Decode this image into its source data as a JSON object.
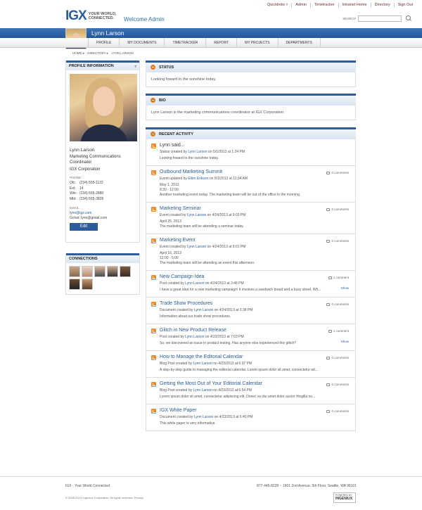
{
  "topnav": [
    "Quicklinks ▿",
    "Admin",
    "Timetracker",
    "Intranet Home",
    "Directory",
    "Sign Out"
  ],
  "logo": {
    "mark": "IGX",
    "tagline": "YOUR WORLD, CONNECTED."
  },
  "welcome": "Welcome Admin",
  "search": {
    "label": "SEARCH",
    "placeholder": ""
  },
  "user": {
    "name": "Lynn Larson"
  },
  "tabs": [
    "PROFILE",
    "MY DOCUMENTS",
    "TIMETRACKER",
    "REPORT",
    "MY PROJECTS",
    "DEPARTMENTS"
  ],
  "breadcrumb": [
    "HOME ▸",
    "DIRECTORY ▸",
    "LYNN LARSON"
  ],
  "profile": {
    "heading": "PROFILE INFORMATION",
    "name": "Lynn Larson",
    "title": "Marketing Communications Coordinator",
    "company": "IGX Corporation",
    "phone_label": "PHONE:",
    "phones": [
      {
        "k": "Ofc:",
        "v": "(234) 555-1122"
      },
      {
        "k": "Ext:",
        "v": "14"
      },
      {
        "k": "Wrk:",
        "v": "(234) 555-2880"
      },
      {
        "k": "Mbl:",
        "v": "(234) 555-3828"
      }
    ],
    "email_label": "EMAIL:",
    "email": "lynn@igx.com",
    "gchat": "Gchat: lynn@gmail.com",
    "edit": "Edit"
  },
  "connections": {
    "heading": "CONNECTIONS"
  },
  "status": {
    "heading": "STATUS",
    "text": "Looking foward to the sunshine today."
  },
  "bio": {
    "heading": "BIO",
    "text": "Lynn Larson is the marketing communications coordinator at IGX Corporation."
  },
  "activity": {
    "heading": "RECENT ACTIVITY",
    "items": [
      {
        "title": "Lynn said...",
        "pre": "Status created by ",
        "by": "Lynn Larson",
        "post": " on 5/1/2013 at 1:24 PM",
        "text": "Looking foward to the sunshine today.",
        "comments": "",
        "show": ""
      },
      {
        "title": "Outbound Marketing Summit",
        "pre": "Event updated by ",
        "by": "Ellen Erikson",
        "post": " on 5/1/2013 at 11:34 AM",
        "text": "May 1, 2013\n8:30 - 12:00\nAnother marketing event today. The marketing team will be out of the office in the morning.",
        "comments": "0 comments",
        "show": ""
      },
      {
        "title": "Marketing Seminar",
        "pre": "Event created by ",
        "by": "Lynn Larson",
        "post": " on 4/24/2013 at 9:03 PM",
        "text": "April 25, 2013\nThe marketing team will be attending a seminar today.",
        "comments": "0 comments",
        "show": ""
      },
      {
        "title": "Marketing Event",
        "pre": "Event created by ",
        "by": "Lynn Larson",
        "post": " on 4/24/2013 at 9:01 PM",
        "text": "April 16, 2013\n12:00 - 5:00\nThe marketing team will be attending an event this afternoon.",
        "comments": "0 comments",
        "show": ""
      },
      {
        "title": "New Campaign Idea",
        "pre": "Post created by ",
        "by": "Lynn Larson",
        "post": " on 4/24/2013 at 3:48 PM",
        "text": "I have a great idea for a new marketing campaign! It involves a sandwich board and a busy street. Wh...",
        "comments": "1 comment",
        "show": "Show"
      },
      {
        "title": "Trade Show Procedures",
        "pre": "Document created by ",
        "by": "Lynn Larson",
        "post": " on 4/24/2013 at 3:38 PM",
        "text": "Information about our trade show procedures.",
        "comments": "0 comments",
        "show": ""
      },
      {
        "title": "Glitch in New Product Release",
        "pre": "Post created by ",
        "by": "Lynn Larson",
        "post": " on 4/23/2013 at 7:03 PM",
        "text": "So, we discovered an issue in product testing. Has anyone else experienced this glitch?",
        "comments": "1 comment",
        "show": "Show"
      },
      {
        "title": "How to Manage the Editorial Calendar",
        "pre": "Blog Post created by ",
        "by": "Lynn Larson",
        "post": " on 4/23/2013 at 6:37 PM",
        "text": "A step-by-step guide to managing the editorial calendar. Lorem ipsum dolor sit amet, consectetur ad...",
        "comments": "0 comments",
        "show": ""
      },
      {
        "title": "Getting the Most Out of Your Editorial Calendar",
        "pre": "Blog Post created by ",
        "by": "Lynn Larson",
        "post": " on 4/23/2013 at 6:54 PM",
        "text": "Lorem ipsum dolor sit amet, consectetur adipiscing elit. Donec eu dui amet dolor auctor fringilla no...",
        "comments": "0 comments",
        "show": ""
      },
      {
        "title": "IGX White Paper",
        "pre": "Document created by ",
        "by": "Lynn Larson",
        "post": " on 4/23/2013 at 5:40 PM",
        "text": "This white paper is very informative.",
        "comments": "0 comments",
        "show": ""
      }
    ]
  },
  "footer": {
    "left": "IGX - Your World Connected",
    "right": "877-445-8228 ~ 1601 2nd Avenue, 5th Floor, Seattle, WA 98101",
    "copy": "© 2005-2013 Ingeniux Corporation. All rights reserved.   Privacy",
    "badge_top": "POWERED BY",
    "badge_brand": "INGENIUX"
  },
  "colors": {
    "brand_blue": "#2b5d9c",
    "accent_orange": "#f08a2e",
    "topnav_red": "#7a1f1f"
  }
}
